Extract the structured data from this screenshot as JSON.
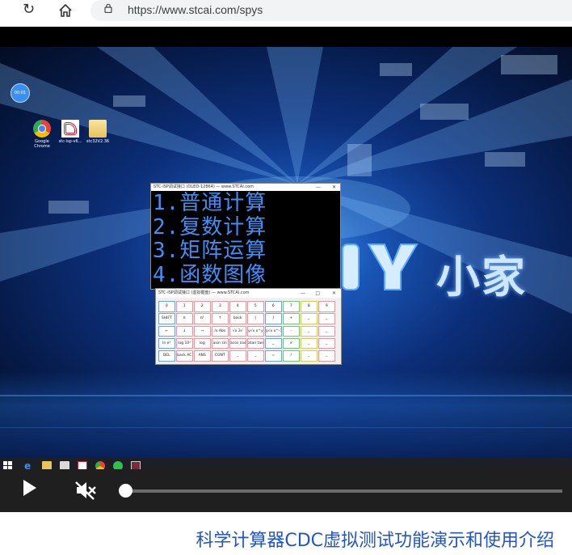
{
  "browser": {
    "url": "https://www.stcai.com/spys",
    "icons": {
      "reload": "reload-icon",
      "home": "home-icon",
      "lock": "lock-icon"
    }
  },
  "video": {
    "timer_badge": "00:01",
    "desktop_icons": [
      {
        "label": "Google Chrome",
        "icon": "chrome-icon"
      },
      {
        "label": "stc-isp-v6...",
        "icon": "stc-isp-icon"
      },
      {
        "label": "stc32V2.36",
        "icon": "folder-icon"
      }
    ],
    "oled_window": {
      "title": "STC-ISP调试接口 (OLED-12864) — www.STCAI.com",
      "lines": [
        "1.普通计算",
        "2.复数计算",
        "3.矩阵运算",
        "4.函数图像"
      ],
      "text_color": "#3f8ff5"
    },
    "keypad_window": {
      "title": "STC-ISP调试接口 (虚拟键盘) — www.STCAI.com",
      "rows": [
        [
          "0",
          "1",
          "2",
          "3",
          "4",
          "5",
          "6",
          "7",
          "8",
          "9"
        ],
        [
          "SHIFT",
          "π",
          "π²",
          "↑",
          "back",
          "(",
          ")",
          "+",
          "_",
          "_"
        ],
        [
          "←",
          "↓",
          "→",
          "/x Abs",
          "√x 3√",
          "y√x x^y",
          "y√x x^-1",
          "-",
          "_",
          "_"
        ],
        [
          "ln eˣ",
          "log 10ˣ",
          "log",
          "asin sin",
          "acos cos",
          "atan tan",
          "_",
          "×",
          "_",
          "_"
        ],
        [
          "DEL",
          "back AC",
          "ANS",
          "CONT",
          "_",
          "_",
          "=",
          "/",
          "_",
          "_"
        ]
      ]
    },
    "logo_text": "小家",
    "taskbar_icons": [
      "windows-start-icon",
      "edge-icon",
      "file-explorer-icon",
      "store-icon",
      "stc-isp-taskbar-icon",
      "chrome-taskbar-icon",
      "wechat-icon",
      "stc-app-icon"
    ]
  },
  "player": {
    "state": "paused",
    "muted": true,
    "progress_fraction": 0.0
  },
  "caption": "科学计算器CDC虚拟测试功能演示和使用介绍",
  "colors": {
    "caption": "#2255cc",
    "controls_bg": "#1f1f1f"
  }
}
